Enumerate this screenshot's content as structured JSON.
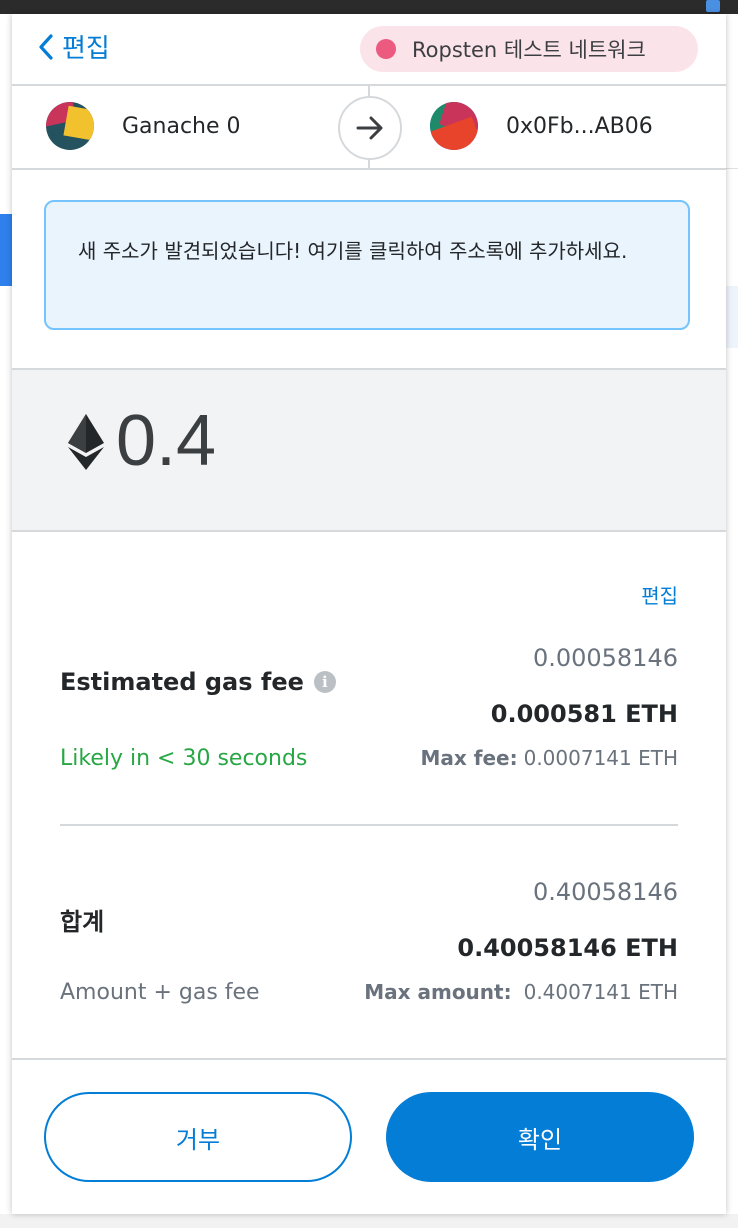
{
  "header": {
    "back_label": "편집",
    "network_label": "Ropsten 테스트 네트워크"
  },
  "sender": {
    "name": "Ganache 0"
  },
  "recipient": {
    "address": "0x0Fb...AB06"
  },
  "notice": {
    "text": "새 주소가 발견되었습니다! 여기를 클릭하여 주소록에 추가하세요."
  },
  "amount": {
    "value": "0.4",
    "icon": "ethereum-icon"
  },
  "gas": {
    "edit_label": "편집",
    "label": "Estimated gas fee",
    "secondary_value": "0.00058146",
    "primary_value": "0.000581 ETH",
    "likely_text": "Likely in < 30 seconds",
    "max_fee_label": "Max fee:",
    "max_fee_value": "0.0007141 ETH"
  },
  "total": {
    "label": "합계",
    "secondary_value": "0.40058146",
    "primary_value": "0.40058146 ETH",
    "subtext": "Amount + gas fee",
    "max_amount_label": "Max amount:",
    "max_amount_value": "0.4007141 ETH"
  },
  "buttons": {
    "reject_label": "거부",
    "confirm_label": "확인"
  },
  "colors": {
    "accent": "#037dd6",
    "network_dot": "#ec5a80",
    "success": "#28a745"
  }
}
